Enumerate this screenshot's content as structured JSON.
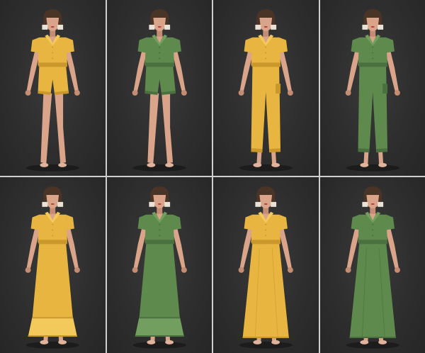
{
  "colors": {
    "yellow": {
      "main": "#e8b640",
      "shade": "#c9972a",
      "light": "#f2c95a"
    },
    "green": {
      "main": "#5f8a4e",
      "shade": "#4a7040",
      "light": "#729e5f"
    },
    "skin": "#d9a489",
    "skin_shade": "#c48c72",
    "hair": "#4a3426",
    "hair_tip": "#e9e2d6",
    "shoe": "#e0b49c"
  },
  "panels": [
    {
      "outfit": "shorts-jumpsuit",
      "color": "yellow"
    },
    {
      "outfit": "shorts-jumpsuit",
      "color": "green"
    },
    {
      "outfit": "long-jumpsuit",
      "color": "yellow"
    },
    {
      "outfit": "long-jumpsuit",
      "color": "green"
    },
    {
      "outfit": "tiered-maxi-dress",
      "color": "yellow"
    },
    {
      "outfit": "tiered-maxi-dress",
      "color": "green"
    },
    {
      "outfit": "maxi-dress",
      "color": "yellow"
    },
    {
      "outfit": "maxi-dress",
      "color": "green"
    }
  ]
}
